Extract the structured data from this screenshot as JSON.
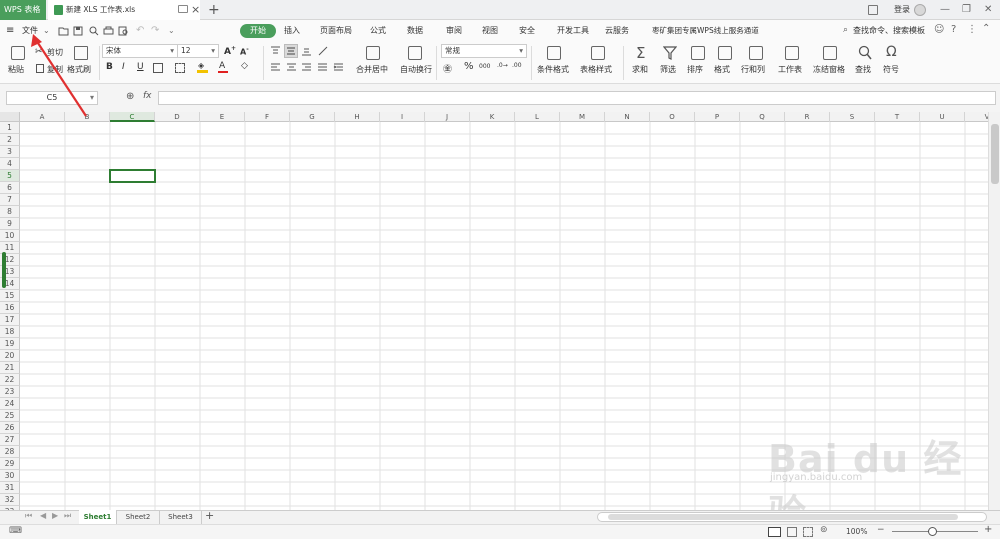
{
  "titlebar": {
    "app_tab": "WPS 表格",
    "doc_tab": "新建 XLS 工作表.xls",
    "close": "×",
    "new_tab": "+",
    "login": "登录",
    "minimize": "—",
    "restore": "❐",
    "close_window": "✕"
  },
  "menu": {
    "menu_icon": "≡",
    "file": "文件",
    "search": "查找命令、搜索模板",
    "tabs": [
      "开始",
      "插入",
      "页面布局",
      "公式",
      "数据",
      "审阅",
      "视图",
      "安全",
      "开发工具",
      "云服务",
      "枣矿集团专属WPS线上服务通道"
    ]
  },
  "ribbon": {
    "paste": "粘贴",
    "cut": "剪切",
    "copy": "复制",
    "format_painter": "格式刷",
    "font_name": "宋体",
    "font_size": "12",
    "bold": "B",
    "italic": "I",
    "underline": "U",
    "merge_center": "合并居中",
    "wrap_text": "自动换行",
    "number_format": "常规",
    "percent": "%",
    "thousands": "000",
    "conditional_format": "条件格式",
    "table_style": "表格样式",
    "sum": "求和",
    "filter": "筛选",
    "sort": "排序",
    "format": "格式",
    "rows_cols": "行和列",
    "worksheet": "工作表",
    "freeze": "冻结窗格",
    "find": "查找",
    "symbol": "符号"
  },
  "formula_bar": {
    "cell_ref": "C5",
    "fx": "fx",
    "content": ""
  },
  "grid": {
    "columns": [
      "A",
      "B",
      "C",
      "D",
      "E",
      "F",
      "G",
      "H",
      "I",
      "J",
      "K",
      "L",
      "M",
      "N",
      "O",
      "P",
      "Q",
      "R",
      "S",
      "T",
      "U",
      "V"
    ],
    "rows": [
      "1",
      "2",
      "3",
      "4",
      "5",
      "6",
      "7",
      "8",
      "9",
      "10",
      "11",
      "12",
      "13",
      "14",
      "15",
      "16",
      "17",
      "18",
      "19",
      "20",
      "21",
      "22",
      "23",
      "24",
      "25",
      "26",
      "27",
      "28",
      "29",
      "30",
      "31",
      "32",
      "33"
    ],
    "selected_column": "C",
    "selected_row": "5"
  },
  "sheets": {
    "tabs": [
      "Sheet1",
      "Sheet2",
      "Sheet3"
    ],
    "active": "Sheet1",
    "add": "+"
  },
  "status": {
    "zoom": "100%",
    "zoom_minus": "−",
    "zoom_plus": "+"
  },
  "watermark": {
    "text": "Bai du 经验",
    "url": "jingyan.baidu.com"
  },
  "colors": {
    "accent": "#4a9e5c",
    "selection": "#2e7d32",
    "arrow": "#e03030"
  }
}
